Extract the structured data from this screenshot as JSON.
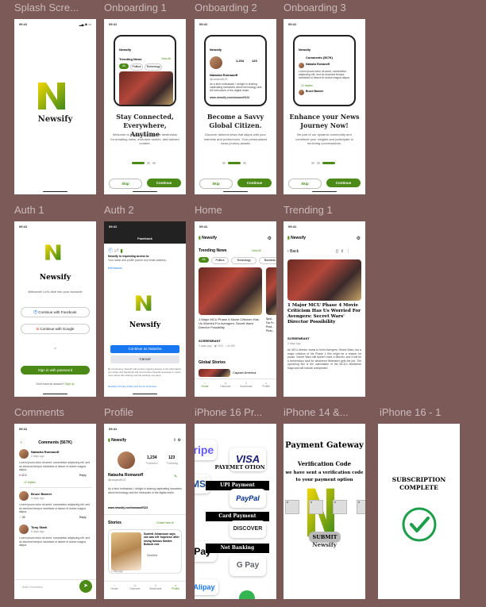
{
  "frames": [
    "Splash Scre...",
    "Onboarding 1",
    "Onboarding 2",
    "Onboarding 3",
    "Auth 1",
    "Auth 2",
    "Home",
    "Trending 1",
    "Comments",
    "Profile",
    "iPhone 16 Pr...",
    "iPhone 14 &...",
    "iPhone 16 - 1"
  ],
  "status_time": "09:41",
  "brand": "Newsify",
  "onb": [
    {
      "title": "Stay Connected, Everywhere, Anytime",
      "body": "Welcome to Newsify, your ultimate destination for breaking news, exclusive stories, and tailored content."
    },
    {
      "title": "Become a Savvy Global Citizen.",
      "body": "Discover tailored news that aligns with your interests and preferences. Your personalized news journey awaits!"
    },
    {
      "title": "Enhance your News Journey Now!",
      "body": "Be part of our dynamic community and contribute your insights and participate in enriching conversations."
    }
  ],
  "skip": "Skip",
  "continue": "Continue",
  "trending_news": "Trending News",
  "view_all": "View All",
  "tabs": [
    "All",
    "Politics",
    "Technology",
    "Business"
  ],
  "auth1": {
    "welcome": "Welcome! Let's dive into your account!",
    "facebook": "Continue with Facebook",
    "google": "Continue with Google",
    "or": "or",
    "signin": "Sign in with password",
    "noacc": "Don't have an account?",
    "signup": "Sign up"
  },
  "auth2": {
    "header": "Facebook",
    "req": "Newsify is requesting access to:",
    "req2": "Your name and profile picture and email address.",
    "edit": "Edit Access",
    "cont": "Continue as Natasha",
    "cancel": "Cancel",
    "fine": "By Continuing, Newsify will receive ongoing access to the information you share and Facebook will record when Newsify accesses it. Learn more about this sharing and the settings you have.",
    "policy": "Newsify's Privacy Policy and Terms of Service"
  },
  "home": {
    "headline": "1 Major MCU Phase 4 Movie Criticism Has Us Worried For Avengers: Secret Wars' Director Possibility",
    "source": "SCREENRANT",
    "meta": "3 days ago",
    "views": "7,524",
    "comments": "6,450",
    "global": "Global Stories",
    "global_item": "Captain America",
    "headline2": "Spid... Far Fr... Prod... Pictu...",
    "nav": [
      "Home",
      "Discover",
      "Bookmark",
      "Profile"
    ]
  },
  "trend": {
    "back": "Back",
    "headline": "1 Major MCU Phase 4 Movie Criticism Has Us Worried For Avengers: Secret Wars' Director Possibility",
    "source": "SCREENRANT",
    "meta": "3 days ago",
    "body": "An MCU director wants to helm Avengers: Secret Wars, but a major criticism of his Phase 4 film might be a reason for pause. Secret Wars still doesn't have a director, and it will be a tremendous task for whichever filmmaker gets the job. The upcoming film is the culmination of the MCU's Multiverse Saga and will include unexpected"
  },
  "comments": {
    "title": "Comments (567K)",
    "items": [
      {
        "name": "Natasha Romanoff",
        "time": "2 days ago",
        "text": "Lorem ipsum dolor sit amet, consectetur adipiscing elit, sed do eiusmod tempor incididunt ut labore et dolore magna aliqua.",
        "likes": "12.2",
        "replies": "12 replies"
      },
      {
        "name": "Bruce Banner",
        "time": "4 days ago",
        "text": "Lorem ipsum dolor sit amet, consectetur adipiscing elit, sed do eiusmod tempor incididunt ut labore et dolore magna aliqua.",
        "likes": "32"
      },
      {
        "name": "Tony Stark",
        "time": "6 days ago",
        "text": "Lorem ipsum dolor sit amet, consectetur adipiscing elit, sed do eiusmod tempor incididunt ut labore et dolore magna aliqua."
      }
    ],
    "reply": "Reply",
    "placeholder": "Add Comment"
  },
  "profile": {
    "name": "Natasha Romanoff",
    "handle": "@romanoff123",
    "followers": "1,234",
    "followers_l": "Followers",
    "following": "123",
    "following_l": "Following",
    "bio": "As a tech enthusiast, I delight in sharing captivating narratives about technology and the intricacies of the digital realm.",
    "link": "www.newsify.com/romanoff123",
    "stories": "Stories",
    "create": "Create New",
    "story": "Scarlett Johansson says she was left 'hopeless' after losing famous Sandra Bullock role",
    "story_src": "Deadline",
    "story_meta": "1 day ago"
  },
  "pay": {
    "header": "PAYEMET OTION",
    "upi": "UPI Payment",
    "card": "Card Payment",
    "net": "Net Banking",
    "logos": [
      "tripe",
      "VISA",
      "PayPal",
      "DISCOVER",
      "Pay",
      "G Pay",
      "Alipay"
    ]
  },
  "gateway": {
    "title": "Payment Gateway",
    "vc": "Verification Code",
    "msg": "we have sent a verification code to your payment option",
    "submit": "SUBMIT",
    "brand": "Newsify"
  },
  "sub": {
    "line1": "SUBSCRIPTION",
    "line2": "COMPLETE"
  },
  "colors": {
    "green": "#4b8a17",
    "bg": "#7b5a58"
  }
}
